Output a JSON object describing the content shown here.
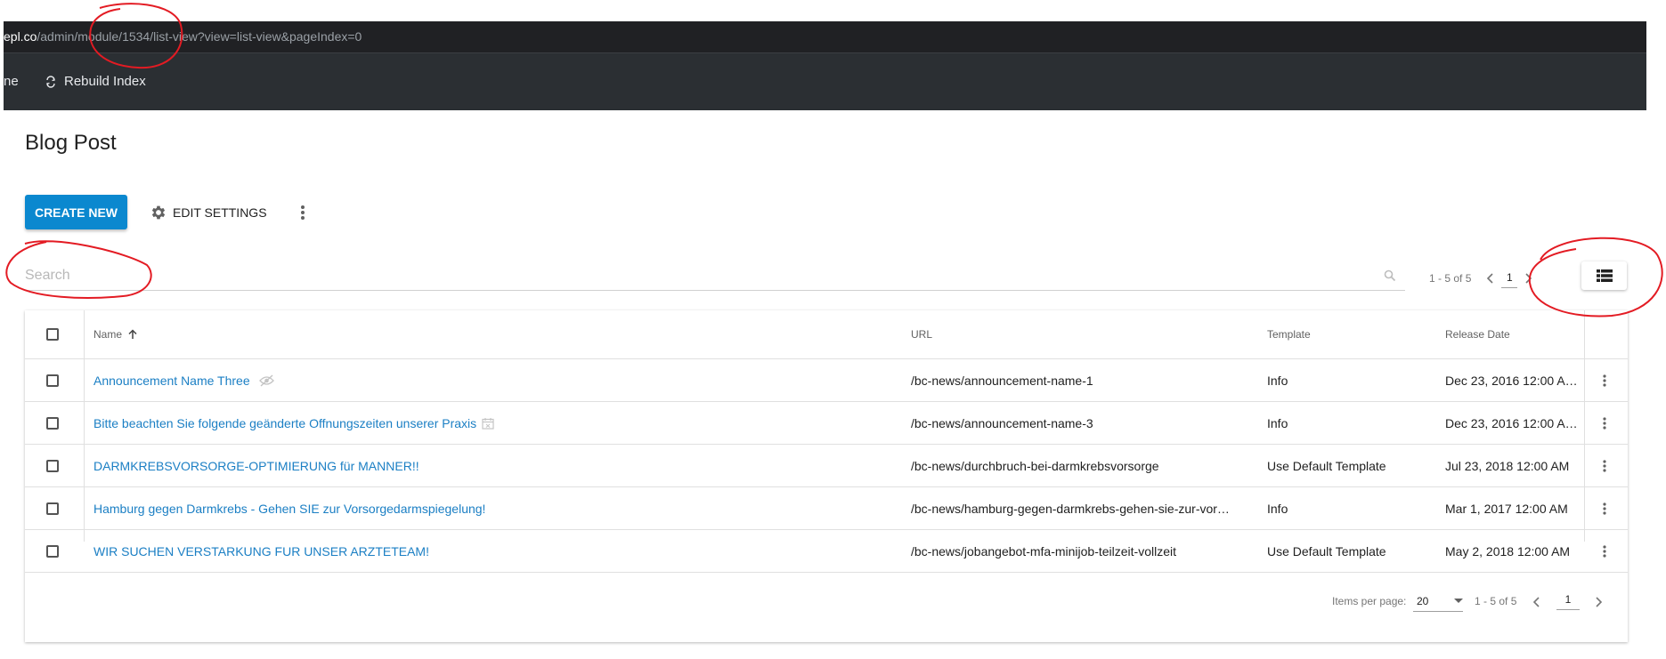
{
  "browser": {
    "url_host": "epl.co",
    "url_path": "/admin/module/1534/list-view?view=list-view&pageIndex=0"
  },
  "appbar": {
    "cut_label": "ne",
    "rebuild_label": "Rebuild Index",
    "rebuild_icon": "refresh-icon"
  },
  "page": {
    "title": "Blog Post"
  },
  "toolbar": {
    "create_label": "CREATE NEW",
    "edit_settings_label": "EDIT SETTINGS",
    "settings_icon": "gear-icon",
    "more_icon": "more-vert-icon"
  },
  "search": {
    "placeholder": "Search",
    "value": ""
  },
  "pager_top": {
    "range": "1 - 5 of 5",
    "page": "1"
  },
  "view_toggle": {
    "icon": "list-view-icon"
  },
  "table": {
    "columns": {
      "name": "Name",
      "url": "URL",
      "template": "Template",
      "release_date": "Release Date"
    },
    "sort_icon": "arrow-up-icon",
    "rows": [
      {
        "name": "Announcement Name Three",
        "url": "/bc-news/announcement-name-1",
        "template": "Info",
        "release_date": "Dec 23, 2016 12:00 A…",
        "status_icon": "hidden-eye-icon"
      },
      {
        "name": "Bitte beachten Sie folgende geänderte Offnungszeiten unserer Praxis",
        "url": "/bc-news/announcement-name-3",
        "template": "Info",
        "release_date": "Dec 23, 2016 12:00 A…",
        "status_icon": "calendar-icon"
      },
      {
        "name": "DARMKREBSVORSORGE-OPTIMIERUNG für MANNER!!",
        "url": "/bc-news/durchbruch-bei-darmkrebsvorsorge",
        "template": "Use Default Template",
        "release_date": "Jul 23, 2018 12:00 AM",
        "status_icon": ""
      },
      {
        "name": "Hamburg gegen Darmkrebs - Gehen SIE zur Vorsorgedarmspiegelung!",
        "url": "/bc-news/hamburg-gegen-darmkrebs-gehen-sie-zur-vor…",
        "template": "Info",
        "release_date": "Mar 1, 2017 12:00 AM",
        "status_icon": ""
      },
      {
        "name": "WIR SUCHEN VERSTARKUNG FUR UNSER ARZTETEAM!",
        "url": "/bc-news/jobangebot-mfa-minijob-teilzeit-vollzeit",
        "template": "Use Default Template",
        "release_date": "May 2, 2018 12:00 AM",
        "status_icon": ""
      }
    ]
  },
  "footer": {
    "items_per_page_label": "Items per page:",
    "items_per_page_value": "20",
    "range": "1 - 5 of 5",
    "page": "1"
  },
  "colors": {
    "primary_button": "#0b88cf",
    "link": "#1b7fc4",
    "appbar": "#2b2f33",
    "annotation": "#e31b23"
  }
}
